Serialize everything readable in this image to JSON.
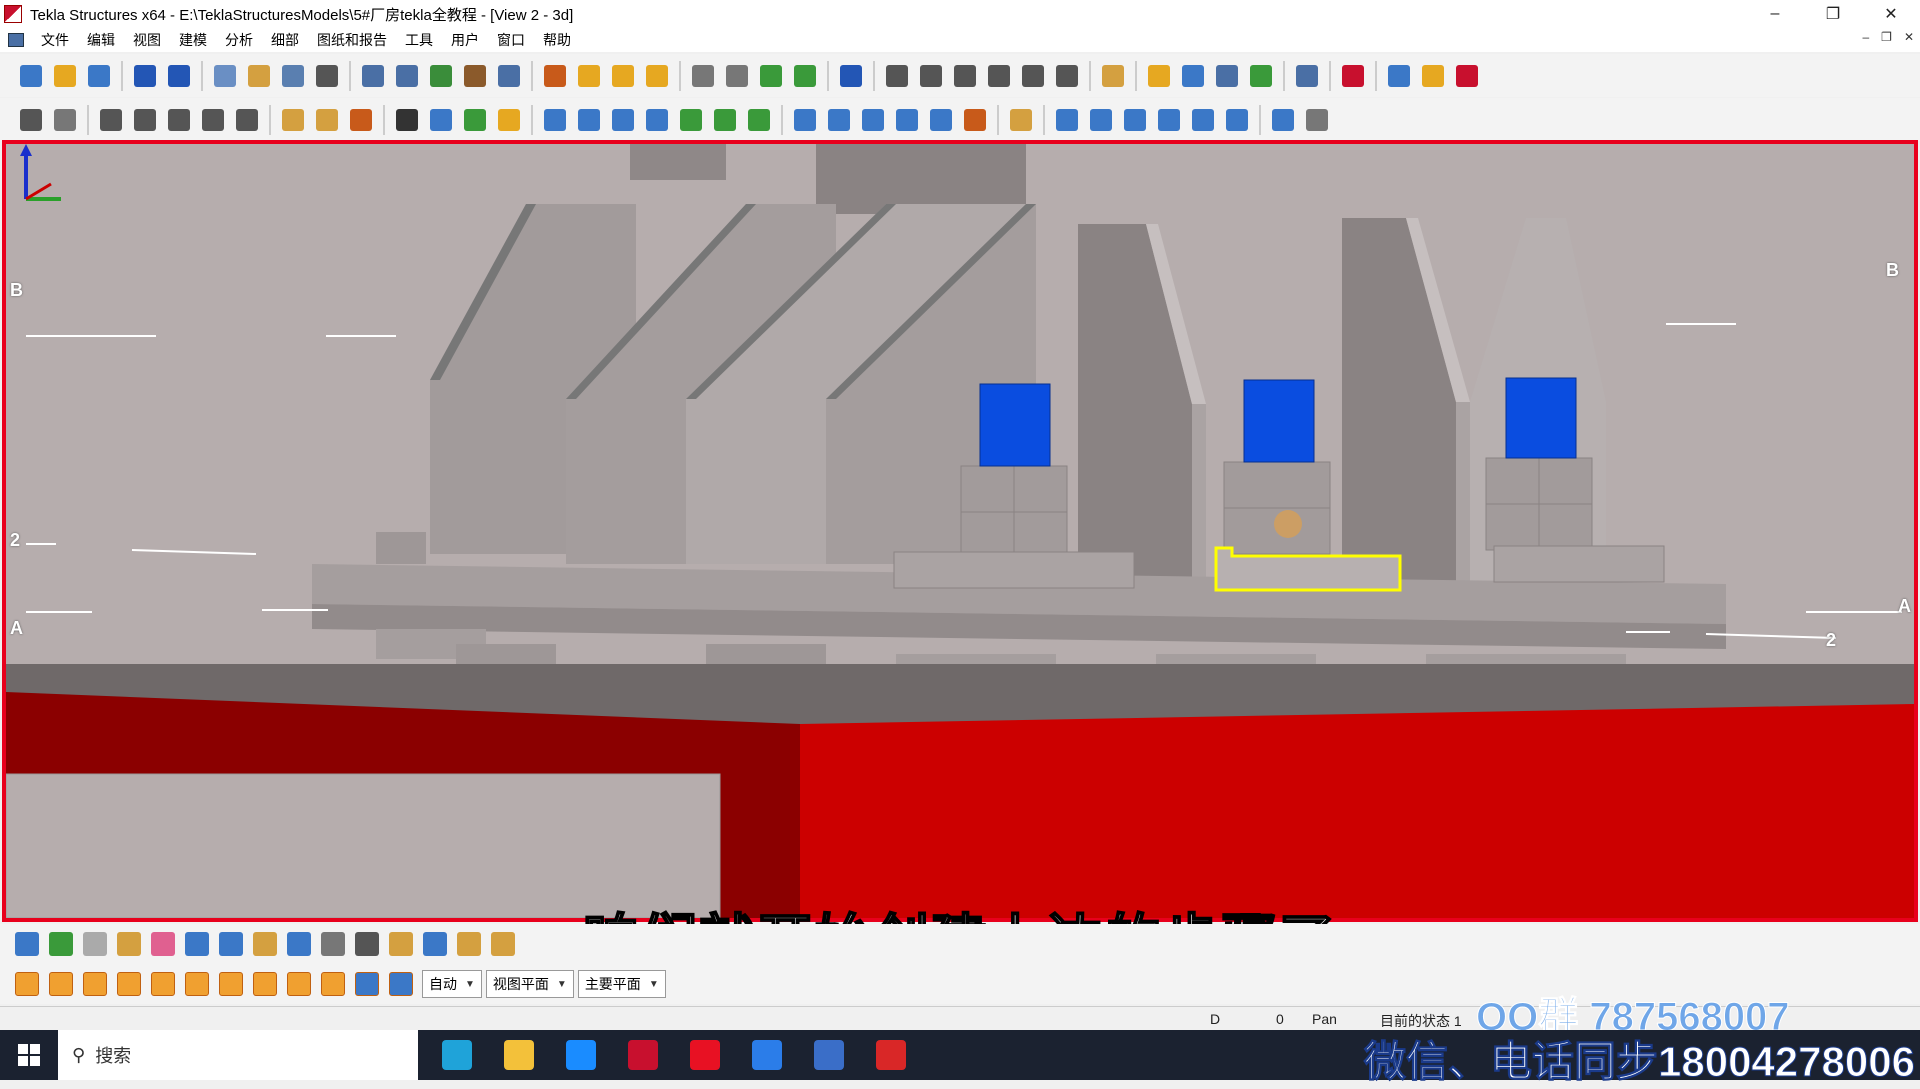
{
  "window": {
    "title": "Tekla Structures x64 - E:\\TeklaStructuresModels\\5#厂房tekla全教程 - [View 2 - 3d]",
    "minimize": "–",
    "maximize": "❐",
    "close": "✕"
  },
  "menu": {
    "items": [
      "文件",
      "编辑",
      "视图",
      "建模",
      "分析",
      "细部",
      "图纸和报告",
      "工具",
      "用户",
      "窗口",
      "帮助"
    ],
    "mdi_min": "–",
    "mdi_restore": "❐",
    "mdi_close": "✕"
  },
  "toolbar1": {
    "icons": [
      "new-icon",
      "open-icon",
      "save-icon",
      "undo-icon",
      "redo-icon",
      "copy-icon",
      "move-icon",
      "document-icon",
      "properties-icon",
      "view-icon",
      "view-list-icon",
      "clipboard-icon",
      "scissors-icon",
      "select-icon",
      "xyz-icon",
      "grid-icon",
      "plane-icon",
      "clash-icon",
      "arrow-icon",
      "arrow-right-icon",
      "component-icon",
      "component2-icon",
      "help-icon",
      "dimension-icon",
      "dimension2-icon",
      "measure-icon",
      "angle-icon",
      "arc-icon",
      "point-icon",
      "pin-icon",
      "layers-icon",
      "switch-icon",
      "report-icon",
      "drawing-icon",
      "catalog-icon",
      "tekla-icon",
      "forward-icon",
      "folder-icon",
      "settings-icon"
    ],
    "colors": [
      "#3b78c7",
      "#e6a821",
      "#3b78c7",
      "#2356b5",
      "#2356b5",
      "#6a8fc4",
      "#d4a040",
      "#5a7fb0",
      "#555",
      "#4a6fa5",
      "#4a6fa5",
      "#3a8d3a",
      "#8b5a2b",
      "#4a6fa5",
      "#c85a1a",
      "#e6a821",
      "#e6a821",
      "#e6a821",
      "#777",
      "#777",
      "#3a9a3a",
      "#3a9a3a",
      "#2356b5",
      "#555",
      "#555",
      "#555",
      "#555",
      "#555",
      "#555",
      "#d4a040",
      "#e6a821",
      "#3b78c7",
      "#4a6fa5",
      "#3a9a3a",
      "#4a6fa5",
      "#c8102e",
      "#3b78c7",
      "#e6a821",
      "#c8102e"
    ]
  },
  "toolbar2": {
    "icons": [
      "create-view-icon",
      "erase-icon",
      "column-icon",
      "beam-icon",
      "polybeam-icon",
      "slab-icon",
      "panel-icon",
      "bolt-icon",
      "weld-icon",
      "rebar-icon",
      "binoculars-icon",
      "part-icon",
      "modify-icon",
      "material-icon",
      "column2-icon",
      "brace-icon",
      "cut-icon",
      "fit-icon",
      "connection-icon",
      "connection2-icon",
      "connection3-icon",
      "pipe-icon",
      "beam2-icon",
      "curved-icon",
      "bent-icon",
      "flat-icon",
      "sheet-icon",
      "pad-icon",
      "line-icon",
      "dashed-line-icon",
      "parallel-icon",
      "cross-line-icon",
      "cross-icon",
      "point2-icon",
      "slash-icon",
      "circle-icon"
    ],
    "colors": [
      "#555",
      "#777",
      "#555",
      "#555",
      "#555",
      "#555",
      "#555",
      "#d4a040",
      "#d4a040",
      "#c85a1a",
      "#333",
      "#3b78c7",
      "#3a9a3a",
      "#e6a821",
      "#3b78c7",
      "#3b78c7",
      "#3b78c7",
      "#3b78c7",
      "#3a9a3a",
      "#3a9a3a",
      "#3a9a3a",
      "#3b78c7",
      "#3b78c7",
      "#3b78c7",
      "#3b78c7",
      "#3b78c7",
      "#c85a1a",
      "#d4a040",
      "#3b78c7",
      "#3b78c7",
      "#3b78c7",
      "#3b78c7",
      "#3b78c7",
      "#3b78c7",
      "#3b78c7",
      "#777"
    ]
  },
  "viewport": {
    "grid_labels": {
      "b_left": "B",
      "b_right": "B",
      "two_left": "2",
      "two_right": "2",
      "a_left": "A",
      "a_right": "A"
    },
    "selection_color": "#ffff00",
    "bolt_color": "#0a4de0",
    "concrete_color": "#b6adad",
    "border_color": "#e8001c"
  },
  "snapbar": {
    "icons": [
      "select-all-icon",
      "select-part-icon",
      "select-surface-icon",
      "select-object-icon",
      "select-grid-icon",
      "select-grid2-icon",
      "select-cut-icon",
      "select-weld-icon",
      "select-rebar-icon",
      "select-view-icon",
      "select-component-icon",
      "select-bolt-icon",
      "select-assembly-icon",
      "select-plane-icon",
      "select-tool-icon"
    ],
    "snap_icons": [
      "snap-reference-icon",
      "snap-square-icon",
      "snap-circle-icon",
      "snap-triangle-icon",
      "snap-cross-icon",
      "snap-corner-icon",
      "snap-x-icon",
      "snap-check-icon",
      "snap-hourglass-icon",
      "snap-arrow-icon",
      "snap-box-icon",
      "snap-box2-icon"
    ],
    "dropdowns": [
      "自动",
      "视图平面",
      "主要平面"
    ]
  },
  "subtitle": "咱们就开始创建上边的步骤了",
  "watermark": {
    "qq": "QQ群 787568007",
    "wechat": "微信、电话同步18004278006"
  },
  "status": {
    "d": "D",
    "zero": "0",
    "pan": "Pan",
    "current_state": "目前的状态 1"
  },
  "taskbar": {
    "search_placeholder": "搜索",
    "apps": [
      "edge-icon",
      "file-explorer-icon",
      "search-app-icon",
      "tekla-app-icon",
      "opera-icon",
      "kuaiya-icon",
      "cad-icon",
      "wps-icon"
    ],
    "app_colors": [
      "#1fa3d9",
      "#f3c13a",
      "#1a8cff",
      "#c8102e",
      "#e81123",
      "#2b7de9",
      "#3a6ec8",
      "#d92727"
    ]
  }
}
